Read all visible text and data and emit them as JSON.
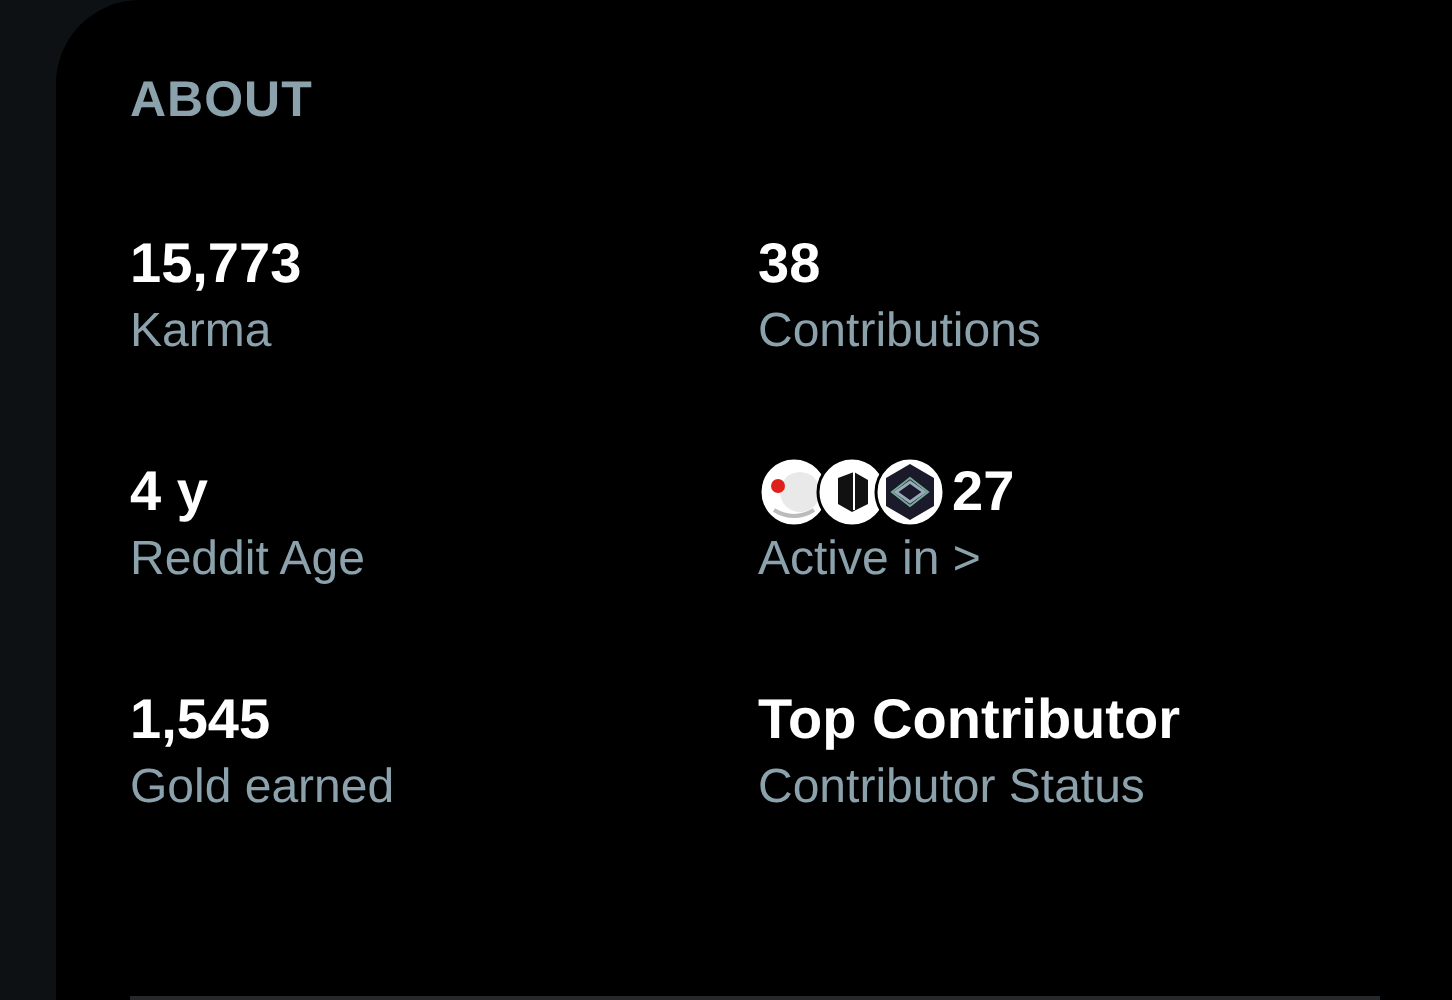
{
  "heading": "ABOUT",
  "stats": [
    {
      "kind": "plain",
      "value": "15,773",
      "label": "Karma"
    },
    {
      "kind": "plain",
      "value": "38",
      "label": "Contributions"
    },
    {
      "kind": "plain",
      "value": "4 y",
      "label": "Reddit Age"
    },
    {
      "kind": "communities",
      "value": "27",
      "label": "Active in >"
    },
    {
      "kind": "plain",
      "value": "1,545",
      "label": "Gold earned"
    },
    {
      "kind": "plain",
      "value": "Top Contributor",
      "label": "Contributor Status"
    }
  ]
}
